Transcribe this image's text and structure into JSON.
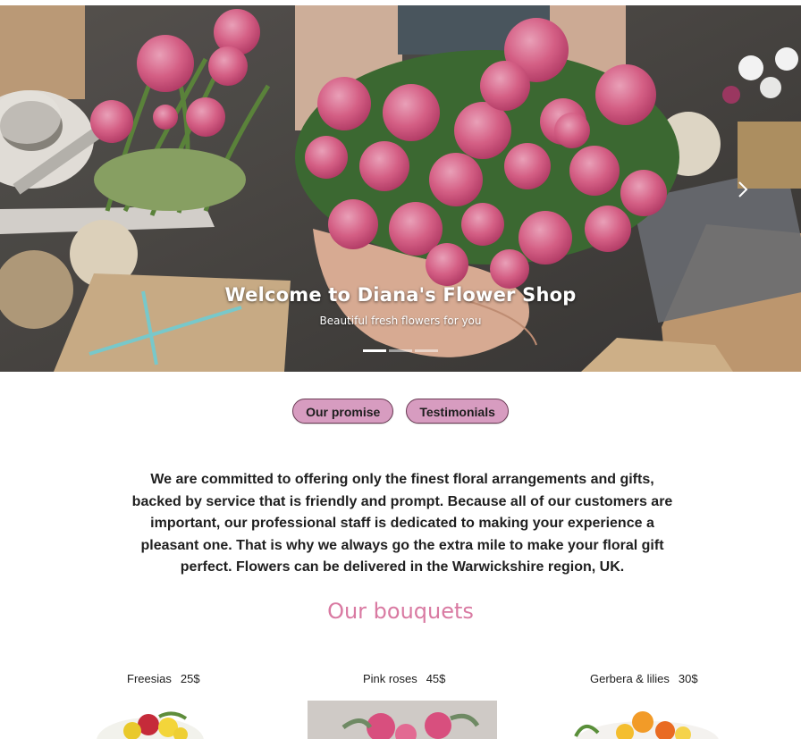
{
  "hero": {
    "title": "Welcome to Diana's Flower Shop",
    "subtitle": "Beautiful fresh flowers for you",
    "indicator_count": 3,
    "active_index": 0
  },
  "buttons": {
    "promise": "Our promise",
    "testimonials": "Testimonials"
  },
  "promise_text": "We are committed to offering only the finest floral arrangements and gifts, backed by service that is friendly and prompt. Because all of our customers are important, our professional staff is dedicated to making your experience a pleasant one. That is why we always go the extra mile to make your floral gift perfect. Flowers can be delivered in the Warwickshire region, UK.",
  "bouquets_title": "Our bouquets",
  "bouquets": [
    {
      "name": "Freesias",
      "price": "25$"
    },
    {
      "name": "Pink roses",
      "price": "45$"
    },
    {
      "name": "Gerbera & lilies",
      "price": "30$"
    }
  ],
  "colors": {
    "button_bg": "#d79cc0",
    "button_border": "#6b3b55",
    "section_title": "#d97aa2",
    "rose": "#e0648c"
  },
  "icons": {
    "carousel_next": "chevron-right-icon"
  }
}
